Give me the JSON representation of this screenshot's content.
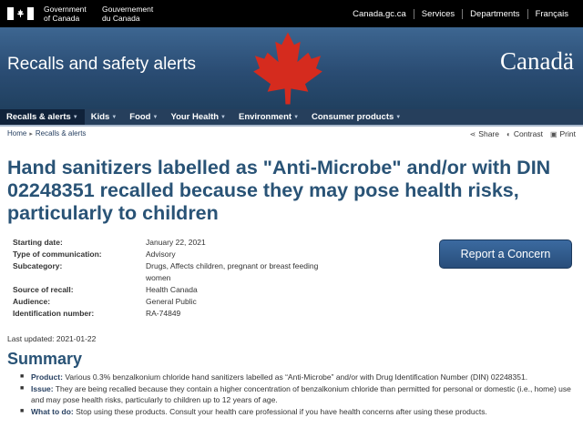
{
  "gov": {
    "name_en_1": "Government",
    "name_en_2": "of Canada",
    "name_fr_1": "Gouvernement",
    "name_fr_2": "du Canada",
    "links": [
      "Canada.gc.ca",
      "Services",
      "Departments",
      "Français"
    ]
  },
  "banner": {
    "title": "Recalls and safety alerts",
    "wordmark": "Canadä"
  },
  "nav": [
    {
      "label": "Recalls & alerts",
      "active": true
    },
    {
      "label": "Kids"
    },
    {
      "label": "Food"
    },
    {
      "label": "Your Health"
    },
    {
      "label": "Environment"
    },
    {
      "label": "Consumer products"
    }
  ],
  "breadcrumb": [
    "Home",
    "Recalls & alerts"
  ],
  "tools": {
    "share": "Share",
    "contrast": "Contrast",
    "print": "Print"
  },
  "title": "Hand sanitizers labelled as \"Anti-Microbe\" and/or with DIN 02248351 recalled because they may pose health risks, particularly to children",
  "details": [
    {
      "label": "Starting date:",
      "value": "January 22, 2021"
    },
    {
      "label": "Type of communication:",
      "value": "Advisory"
    },
    {
      "label": "Subcategory:",
      "value": "Drugs, Affects children, pregnant or breast feeding women"
    },
    {
      "label": "Source of recall:",
      "value": "Health Canada"
    },
    {
      "label": "Audience:",
      "value": "General Public"
    },
    {
      "label": "Identification number:",
      "value": "RA-74849"
    }
  ],
  "report_button": "Report a Concern",
  "last_updated": "Last updated: 2021-01-22",
  "summary": {
    "heading": "Summary",
    "items": [
      {
        "label": "Product:",
        "text": "Various 0.3% benzalkonium chloride hand sanitizers labelled as “Anti-Microbe” and/or with Drug Identification Number (DIN) 02248351."
      },
      {
        "label": "Issue:",
        "text": "They are being recalled because they contain a higher concentration of benzalkonium chloride than permitted for personal or domestic (i.e., home) use and may pose health risks, particularly to children up to 12 years of age."
      },
      {
        "label": "What to do:",
        "text": "Stop using these products. Consult your health care professional if you have health concerns after using these products."
      }
    ]
  }
}
